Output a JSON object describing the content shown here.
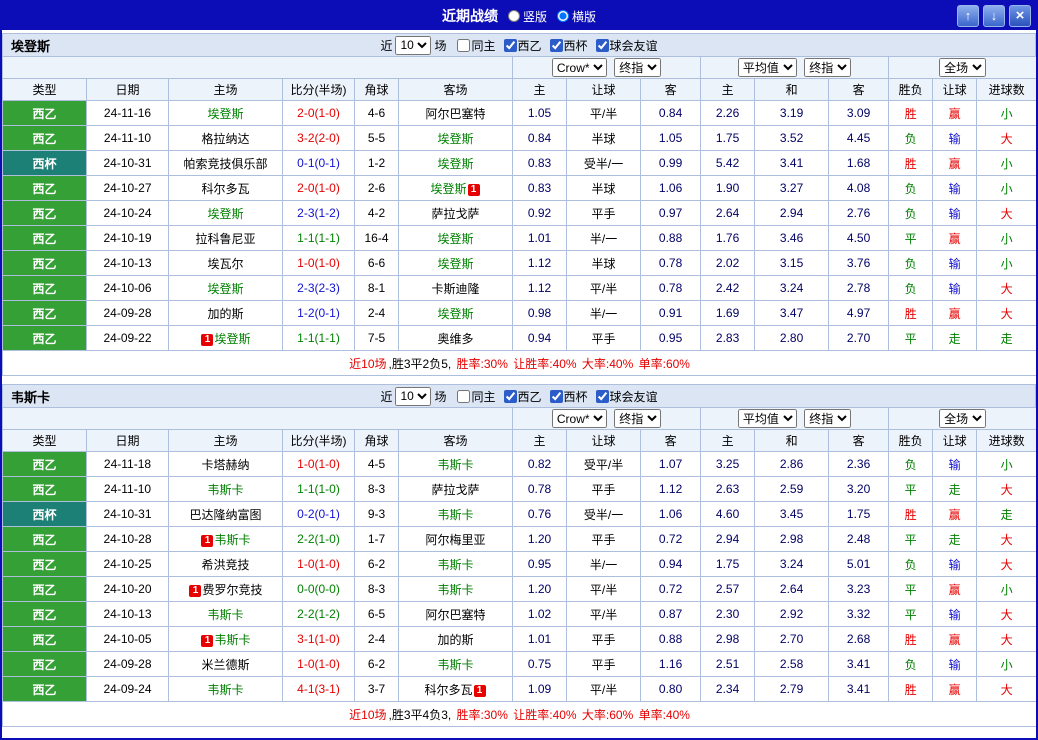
{
  "titlebar": {
    "title": "近期战绩",
    "layout_options": [
      {
        "label": "竖版",
        "selected": false
      },
      {
        "label": "横版",
        "selected": true
      }
    ],
    "icons": {
      "up": "↑",
      "down": "↓",
      "close": "×"
    }
  },
  "filter": {
    "near_label": "近",
    "count_value": "10",
    "games_label": "场",
    "checkboxes": [
      {
        "label": "同主",
        "checked": false
      },
      {
        "label": "西乙",
        "checked": true
      },
      {
        "label": "西杯",
        "checked": true
      },
      {
        "label": "球会友谊",
        "checked": true
      }
    ]
  },
  "dropdowns": {
    "bookmaker": "Crow*",
    "ah_final": "终指",
    "average": "平均值",
    "eu_final": "终指",
    "scope": "全场"
  },
  "table_head": [
    "类型",
    "日期",
    "主场",
    "比分(半场)",
    "角球",
    "客场",
    "主",
    "让球",
    "客",
    "主",
    "和",
    "客",
    "胜负",
    "让球",
    "进球数"
  ],
  "colors": {
    "red": "#e60000",
    "blue": "#1212d0",
    "green": "#008000",
    "focus_team": "#008000",
    "league_liga": "#35a035",
    "league_cup": "#1d8077"
  },
  "sections": [
    {
      "team": "埃登斯",
      "rows": [
        {
          "league": "西乙",
          "cup": false,
          "date": "24-11-16",
          "home": {
            "name": "埃登斯",
            "focus": true
          },
          "score": "2-0(1-0)",
          "score_result": "home",
          "corner": "4-6",
          "away": {
            "name": "阿尔巴塞特",
            "focus": false
          },
          "ah": [
            "1.05",
            "平/半",
            "0.84"
          ],
          "eu": [
            "2.26",
            "3.19",
            "3.09"
          ],
          "results": [
            [
              "胜",
              "red"
            ],
            [
              "赢",
              "red"
            ],
            [
              "小",
              "green"
            ]
          ]
        },
        {
          "league": "西乙",
          "cup": false,
          "date": "24-11-10",
          "home": {
            "name": "格拉纳达",
            "focus": false
          },
          "score": "3-2(2-0)",
          "score_result": "home",
          "corner": "5-5",
          "away": {
            "name": "埃登斯",
            "focus": true
          },
          "ah": [
            "0.84",
            "半球",
            "1.05"
          ],
          "eu": [
            "1.75",
            "3.52",
            "4.45"
          ],
          "results": [
            [
              "负",
              "green"
            ],
            [
              "输",
              "blue"
            ],
            [
              "大",
              "red"
            ]
          ]
        },
        {
          "league": "西杯",
          "cup": true,
          "date": "24-10-31",
          "home": {
            "name": "帕索竞技俱乐部",
            "focus": false
          },
          "score": "0-1(0-1)",
          "score_result": "away",
          "corner": "1-2",
          "away": {
            "name": "埃登斯",
            "focus": true
          },
          "ah": [
            "0.83",
            "受半/一",
            "0.99"
          ],
          "eu": [
            "5.42",
            "3.41",
            "1.68"
          ],
          "results": [
            [
              "胜",
              "red"
            ],
            [
              "赢",
              "red"
            ],
            [
              "小",
              "green"
            ]
          ]
        },
        {
          "league": "西乙",
          "cup": false,
          "date": "24-10-27",
          "home": {
            "name": "科尔多瓦",
            "focus": false
          },
          "score": "2-0(1-0)",
          "score_result": "home",
          "corner": "2-6",
          "away": {
            "name": "埃登斯",
            "focus": true,
            "badge_after": "1"
          },
          "ah": [
            "0.83",
            "半球",
            "1.06"
          ],
          "eu": [
            "1.90",
            "3.27",
            "4.08"
          ],
          "results": [
            [
              "负",
              "green"
            ],
            [
              "输",
              "blue"
            ],
            [
              "小",
              "green"
            ]
          ]
        },
        {
          "league": "西乙",
          "cup": false,
          "date": "24-10-24",
          "home": {
            "name": "埃登斯",
            "focus": true
          },
          "score": "2-3(1-2)",
          "score_result": "away",
          "corner": "4-2",
          "away": {
            "name": "萨拉戈萨",
            "focus": false
          },
          "ah": [
            "0.92",
            "平手",
            "0.97"
          ],
          "eu": [
            "2.64",
            "2.94",
            "2.76"
          ],
          "results": [
            [
              "负",
              "green"
            ],
            [
              "输",
              "blue"
            ],
            [
              "大",
              "red"
            ]
          ]
        },
        {
          "league": "西乙",
          "cup": false,
          "date": "24-10-19",
          "home": {
            "name": "拉科鲁尼亚",
            "focus": false
          },
          "score": "1-1(1-1)",
          "score_result": "draw",
          "corner": "16-4",
          "away": {
            "name": "埃登斯",
            "focus": true
          },
          "ah": [
            "1.01",
            "半/一",
            "0.88"
          ],
          "eu": [
            "1.76",
            "3.46",
            "4.50"
          ],
          "results": [
            [
              "平",
              "green"
            ],
            [
              "赢",
              "red"
            ],
            [
              "小",
              "green"
            ]
          ]
        },
        {
          "league": "西乙",
          "cup": false,
          "date": "24-10-13",
          "home": {
            "name": "埃瓦尔",
            "focus": false
          },
          "score": "1-0(1-0)",
          "score_result": "home",
          "corner": "6-6",
          "away": {
            "name": "埃登斯",
            "focus": true
          },
          "ah": [
            "1.12",
            "半球",
            "0.78"
          ],
          "eu": [
            "2.02",
            "3.15",
            "3.76"
          ],
          "results": [
            [
              "负",
              "green"
            ],
            [
              "输",
              "blue"
            ],
            [
              "小",
              "green"
            ]
          ]
        },
        {
          "league": "西乙",
          "cup": false,
          "date": "24-10-06",
          "home": {
            "name": "埃登斯",
            "focus": true
          },
          "score": "2-3(2-3)",
          "score_result": "away",
          "corner": "8-1",
          "away": {
            "name": "卡斯迪隆",
            "focus": false
          },
          "ah": [
            "1.12",
            "平/半",
            "0.78"
          ],
          "eu": [
            "2.42",
            "3.24",
            "2.78"
          ],
          "results": [
            [
              "负",
              "green"
            ],
            [
              "输",
              "blue"
            ],
            [
              "大",
              "red"
            ]
          ]
        },
        {
          "league": "西乙",
          "cup": false,
          "date": "24-09-28",
          "home": {
            "name": "加的斯",
            "focus": false
          },
          "score": "1-2(0-1)",
          "score_result": "away",
          "corner": "2-4",
          "away": {
            "name": "埃登斯",
            "focus": true
          },
          "ah": [
            "0.98",
            "半/一",
            "0.91"
          ],
          "eu": [
            "1.69",
            "3.47",
            "4.97"
          ],
          "results": [
            [
              "胜",
              "red"
            ],
            [
              "赢",
              "red"
            ],
            [
              "大",
              "red"
            ]
          ]
        },
        {
          "league": "西乙",
          "cup": false,
          "date": "24-09-22",
          "home": {
            "name": "埃登斯",
            "focus": true,
            "badge_before": "1"
          },
          "score": "1-1(1-1)",
          "score_result": "draw",
          "corner": "7-5",
          "away": {
            "name": "奥维多",
            "focus": false
          },
          "ah": [
            "0.94",
            "平手",
            "0.95"
          ],
          "eu": [
            "2.83",
            "2.80",
            "2.70"
          ],
          "results": [
            [
              "平",
              "green"
            ],
            [
              "走",
              "green"
            ],
            [
              "走",
              "green"
            ]
          ]
        }
      ],
      "footer": [
        [
          "近10场",
          "red"
        ],
        [
          ",胜3平2负5, ",
          "black"
        ],
        [
          "胜率:30% ",
          "red"
        ],
        [
          "让胜率:40% ",
          "red"
        ],
        [
          "大率:40% ",
          "red"
        ],
        [
          "单率:60%",
          "red"
        ]
      ]
    },
    {
      "team": "韦斯卡",
      "rows": [
        {
          "league": "西乙",
          "cup": false,
          "date": "24-11-18",
          "home": {
            "name": "卡塔赫纳",
            "focus": false
          },
          "score": "1-0(1-0)",
          "score_result": "home",
          "corner": "4-5",
          "away": {
            "name": "韦斯卡",
            "focus": true
          },
          "ah": [
            "0.82",
            "受平/半",
            "1.07"
          ],
          "eu": [
            "3.25",
            "2.86",
            "2.36"
          ],
          "results": [
            [
              "负",
              "green"
            ],
            [
              "输",
              "blue"
            ],
            [
              "小",
              "green"
            ]
          ]
        },
        {
          "league": "西乙",
          "cup": false,
          "date": "24-11-10",
          "home": {
            "name": "韦斯卡",
            "focus": true
          },
          "score": "1-1(1-0)",
          "score_result": "draw",
          "corner": "8-3",
          "away": {
            "name": "萨拉戈萨",
            "focus": false
          },
          "ah": [
            "0.78",
            "平手",
            "1.12"
          ],
          "eu": [
            "2.63",
            "2.59",
            "3.20"
          ],
          "results": [
            [
              "平",
              "green"
            ],
            [
              "走",
              "green"
            ],
            [
              "大",
              "red"
            ]
          ]
        },
        {
          "league": "西杯",
          "cup": true,
          "date": "24-10-31",
          "home": {
            "name": "巴达隆纳富图",
            "focus": false
          },
          "score": "0-2(0-1)",
          "score_result": "away",
          "corner": "9-3",
          "away": {
            "name": "韦斯卡",
            "focus": true
          },
          "ah": [
            "0.76",
            "受半/一",
            "1.06"
          ],
          "eu": [
            "4.60",
            "3.45",
            "1.75"
          ],
          "results": [
            [
              "胜",
              "red"
            ],
            [
              "赢",
              "red"
            ],
            [
              "走",
              "green"
            ]
          ]
        },
        {
          "league": "西乙",
          "cup": false,
          "date": "24-10-28",
          "home": {
            "name": "韦斯卡",
            "focus": true,
            "badge_before": "1"
          },
          "score": "2-2(1-0)",
          "score_result": "draw",
          "corner": "1-7",
          "away": {
            "name": "阿尔梅里亚",
            "focus": false
          },
          "ah": [
            "1.20",
            "平手",
            "0.72"
          ],
          "eu": [
            "2.94",
            "2.98",
            "2.48"
          ],
          "results": [
            [
              "平",
              "green"
            ],
            [
              "走",
              "green"
            ],
            [
              "大",
              "red"
            ]
          ]
        },
        {
          "league": "西乙",
          "cup": false,
          "date": "24-10-25",
          "home": {
            "name": "希洪竞技",
            "focus": false
          },
          "score": "1-0(1-0)",
          "score_result": "home",
          "corner": "6-2",
          "away": {
            "name": "韦斯卡",
            "focus": true
          },
          "ah": [
            "0.95",
            "半/一",
            "0.94"
          ],
          "eu": [
            "1.75",
            "3.24",
            "5.01"
          ],
          "results": [
            [
              "负",
              "green"
            ],
            [
              "输",
              "blue"
            ],
            [
              "大",
              "red"
            ]
          ]
        },
        {
          "league": "西乙",
          "cup": false,
          "date": "24-10-20",
          "home": {
            "name": "费罗尔竞技",
            "focus": false,
            "badge_before": "1"
          },
          "score": "0-0(0-0)",
          "score_result": "draw",
          "corner": "8-3",
          "away": {
            "name": "韦斯卡",
            "focus": true
          },
          "ah": [
            "1.20",
            "平/半",
            "0.72"
          ],
          "eu": [
            "2.57",
            "2.64",
            "3.23"
          ],
          "results": [
            [
              "平",
              "green"
            ],
            [
              "赢",
              "red"
            ],
            [
              "小",
              "green"
            ]
          ]
        },
        {
          "league": "西乙",
          "cup": false,
          "date": "24-10-13",
          "home": {
            "name": "韦斯卡",
            "focus": true
          },
          "score": "2-2(1-2)",
          "score_result": "draw",
          "corner": "6-5",
          "away": {
            "name": "阿尔巴塞特",
            "focus": false
          },
          "ah": [
            "1.02",
            "平/半",
            "0.87"
          ],
          "eu": [
            "2.30",
            "2.92",
            "3.32"
          ],
          "results": [
            [
              "平",
              "green"
            ],
            [
              "输",
              "blue"
            ],
            [
              "大",
              "red"
            ]
          ]
        },
        {
          "league": "西乙",
          "cup": false,
          "date": "24-10-05",
          "home": {
            "name": "韦斯卡",
            "focus": true,
            "badge_before": "1"
          },
          "score": "3-1(1-0)",
          "score_result": "home",
          "corner": "2-4",
          "away": {
            "name": "加的斯",
            "focus": false
          },
          "ah": [
            "1.01",
            "平手",
            "0.88"
          ],
          "eu": [
            "2.98",
            "2.70",
            "2.68"
          ],
          "results": [
            [
              "胜",
              "red"
            ],
            [
              "赢",
              "red"
            ],
            [
              "大",
              "red"
            ]
          ]
        },
        {
          "league": "西乙",
          "cup": false,
          "date": "24-09-28",
          "home": {
            "name": "米兰德斯",
            "focus": false
          },
          "score": "1-0(1-0)",
          "score_result": "home",
          "corner": "6-2",
          "away": {
            "name": "韦斯卡",
            "focus": true
          },
          "ah": [
            "0.75",
            "平手",
            "1.16"
          ],
          "eu": [
            "2.51",
            "2.58",
            "3.41"
          ],
          "results": [
            [
              "负",
              "green"
            ],
            [
              "输",
              "blue"
            ],
            [
              "小",
              "green"
            ]
          ]
        },
        {
          "league": "西乙",
          "cup": false,
          "date": "24-09-24",
          "home": {
            "name": "韦斯卡",
            "focus": true
          },
          "score": "4-1(3-1)",
          "score_result": "home",
          "corner": "3-7",
          "away": {
            "name": "科尔多瓦",
            "focus": false,
            "badge_after": "1"
          },
          "ah": [
            "1.09",
            "平/半",
            "0.80"
          ],
          "eu": [
            "2.34",
            "2.79",
            "3.41"
          ],
          "results": [
            [
              "胜",
              "red"
            ],
            [
              "赢",
              "red"
            ],
            [
              "大",
              "red"
            ]
          ]
        }
      ],
      "footer": [
        [
          "近10场",
          "red"
        ],
        [
          ",胜3平4负3, ",
          "black"
        ],
        [
          "胜率:30% ",
          "red"
        ],
        [
          "让胜率:40% ",
          "red"
        ],
        [
          "大率:60% ",
          "red"
        ],
        [
          "单率:40%",
          "red"
        ]
      ]
    }
  ]
}
